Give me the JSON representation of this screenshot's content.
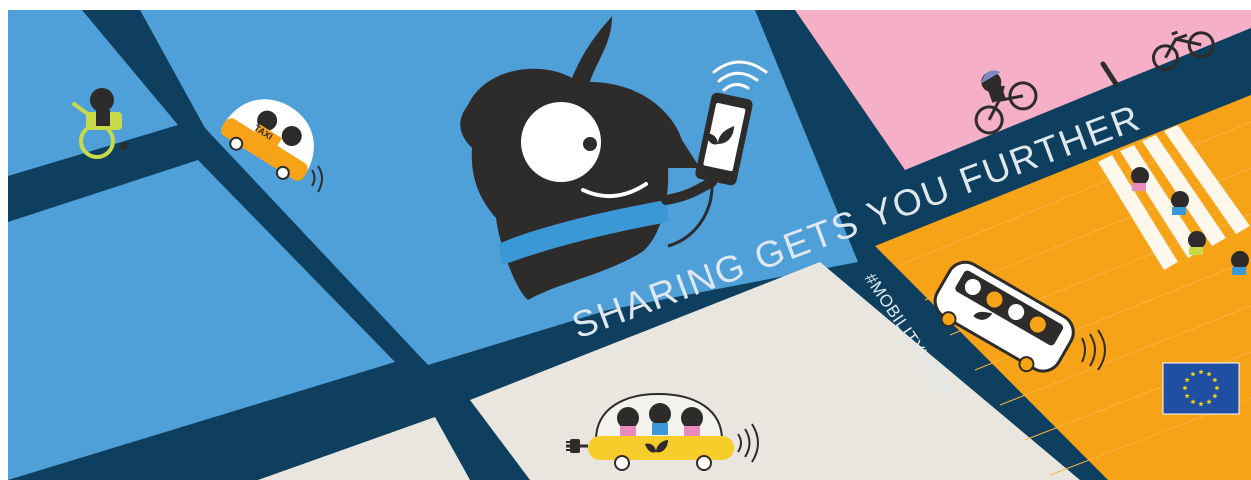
{
  "banner": {
    "slogan": "SHARING GETS YOU FURTHER",
    "hashtag": "#MOBILITYWEEK",
    "taxi_sign": "TAXI"
  },
  "colors": {
    "road": "#0f3f5e",
    "sky_blue": "#4f9fd8",
    "pink": "#f5afc6",
    "orange": "#f6a318",
    "beige": "#e8e6df",
    "character": "#2e2b2b",
    "stripe_blue": "#3b98d6",
    "yellow_car": "#f7cd2c",
    "eu_blue": "#1f4fa3",
    "eu_star": "#f7d317"
  },
  "icons": [
    "mascot-icon",
    "smartphone-icon",
    "wheelchair-user-icon",
    "taxi-icon",
    "cyclist-icon",
    "parked-bicycle-icon",
    "bollard-icon",
    "bus-icon",
    "electric-car-icon",
    "plug-icon",
    "pedestrian-crossing-icon",
    "pedestrian-icon",
    "eu-flag-icon",
    "star-icon",
    "wifi-signal-icon"
  ]
}
